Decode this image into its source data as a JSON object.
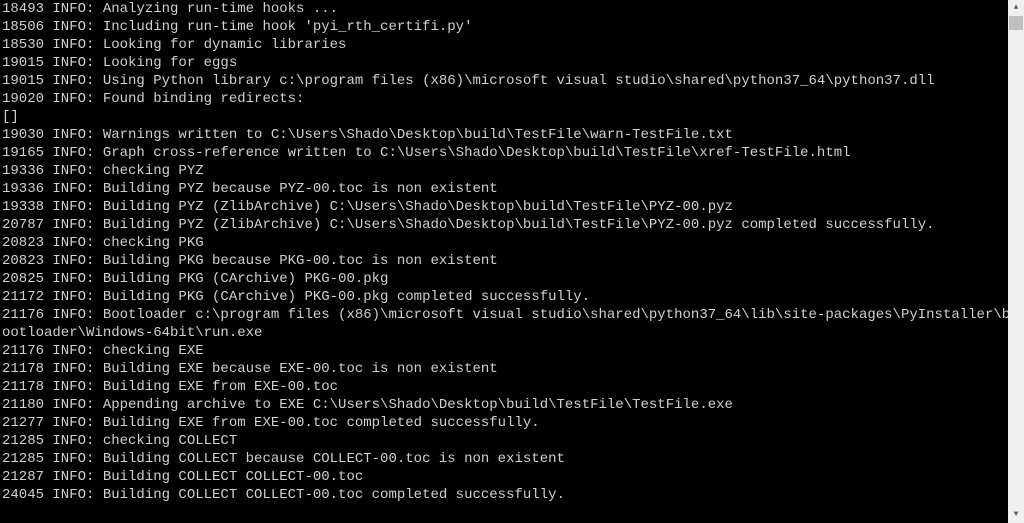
{
  "lines": [
    "18493 INFO: Analyzing run-time hooks ...",
    "18506 INFO: Including run-time hook 'pyi_rth_certifi.py'",
    "18530 INFO: Looking for dynamic libraries",
    "19015 INFO: Looking for eggs",
    "19015 INFO: Using Python library c:\\program files (x86)\\microsoft visual studio\\shared\\python37_64\\python37.dll",
    "19020 INFO: Found binding redirects:",
    "[]",
    "19030 INFO: Warnings written to C:\\Users\\Shado\\Desktop\\build\\TestFile\\warn-TestFile.txt",
    "19165 INFO: Graph cross-reference written to C:\\Users\\Shado\\Desktop\\build\\TestFile\\xref-TestFile.html",
    "19336 INFO: checking PYZ",
    "19336 INFO: Building PYZ because PYZ-00.toc is non existent",
    "19338 INFO: Building PYZ (ZlibArchive) C:\\Users\\Shado\\Desktop\\build\\TestFile\\PYZ-00.pyz",
    "20787 INFO: Building PYZ (ZlibArchive) C:\\Users\\Shado\\Desktop\\build\\TestFile\\PYZ-00.pyz completed successfully.",
    "20823 INFO: checking PKG",
    "20823 INFO: Building PKG because PKG-00.toc is non existent",
    "20825 INFO: Building PKG (CArchive) PKG-00.pkg",
    "21172 INFO: Building PKG (CArchive) PKG-00.pkg completed successfully.",
    "21176 INFO: Bootloader c:\\program files (x86)\\microsoft visual studio\\shared\\python37_64\\lib\\site-packages\\PyInstaller\\b",
    "ootloader\\Windows-64bit\\run.exe",
    "21176 INFO: checking EXE",
    "21178 INFO: Building EXE because EXE-00.toc is non existent",
    "21178 INFO: Building EXE from EXE-00.toc",
    "21180 INFO: Appending archive to EXE C:\\Users\\Shado\\Desktop\\build\\TestFile\\TestFile.exe",
    "21277 INFO: Building EXE from EXE-00.toc completed successfully.",
    "21285 INFO: checking COLLECT",
    "21285 INFO: Building COLLECT because COLLECT-00.toc is non existent",
    "21287 INFO: Building COLLECT COLLECT-00.toc",
    "24045 INFO: Building COLLECT COLLECT-00.toc completed successfully."
  ],
  "scrollbar": {
    "up": "▲",
    "down": "▼"
  }
}
